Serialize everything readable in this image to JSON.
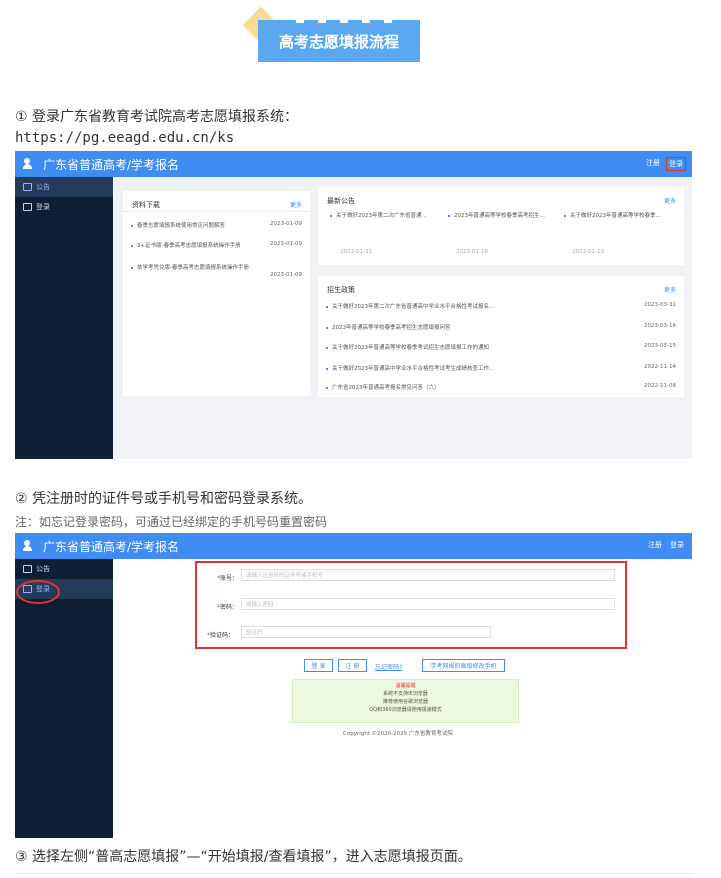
{
  "banner": {
    "title": "高考志愿填报流程"
  },
  "step1": {
    "text": "① 登录广东省教育考试院高考志愿填报系统：",
    "url": "https://pg.eeagd.edu.cn/ks"
  },
  "step2": {
    "text": "② 凭注册时的证件号或手机号和密码登录系统。",
    "note": "注：如忘记登录密码，可通过已经绑定的手机号码重置密码"
  },
  "step3": {
    "text": "③ 选择左侧“普高志愿填报”—“开始填报/查看填报”，进入志愿填报页面。"
  },
  "app": {
    "brand": "广东省普通高考/学考报名",
    "register_link": "注册",
    "login_link": "登录",
    "sidebar": [
      {
        "label": "公告"
      },
      {
        "label": "登录"
      }
    ]
  },
  "downloads": {
    "title": "资料下载",
    "more": "更多",
    "items": [
      {
        "label": "春季志愿填报系统使用常见问题解答",
        "date": "2023-01-09"
      },
      {
        "label": "3+证书版-春季高考志愿填报系统操作手册",
        "date": "2023-01-09"
      },
      {
        "label": "依学考凭兑版-春季高考志愿填报系统操作手册",
        "date": "2023-01-09"
      }
    ]
  },
  "notices": {
    "title": "最新公告",
    "more": "更多",
    "items": [
      {
        "label": "关于做好2023年第二次广东省普通…",
        "date": "2023-01-31"
      },
      {
        "label": "2023年普通高等学校春季高考招生…",
        "date": "2023-01-16"
      },
      {
        "label": "关于做好2023年普通高等学校春季…",
        "date": "2023-01-13"
      }
    ]
  },
  "policies": {
    "title": "招生政策",
    "more": "更多",
    "items": [
      {
        "label": "关于做好2023年第二次广东省普通高中学业水平合格性考试报名…",
        "date": "2023-03-31"
      },
      {
        "label": "2023年普通高等学校春季高考招生志愿填报问答",
        "date": "2023-03-16"
      },
      {
        "label": "关于做好2023年普通高等学校春季考试招生志愿填报工作的通知",
        "date": "2023-03-15"
      },
      {
        "label": "关于做好2023年普通高中学业水平合格性考试考生成绩核查工作…",
        "date": "2022-11-14"
      },
      {
        "label": "广东省2023年普通高考报名常见问答（六）",
        "date": "2022-11-08"
      }
    ]
  },
  "login_form": {
    "account_label": "账号：",
    "account_placeholder": "请输入注册时的证件号或手机号",
    "password_label": "密码：",
    "password_placeholder": "请输入密码",
    "captcha_label": "验证码：",
    "captcha_placeholder": "验证码",
    "login_btn": "登 录",
    "register_btn": "注 册",
    "forgot_link": "忘记密码?",
    "change_phone_btn": "学考网报的高级修改手机",
    "tips": [
      "温馨提醒",
      "系统不支持IE浏览器",
      "推荐使用谷歌浏览器",
      "QQ和360浏览器请使用极速模式"
    ],
    "copyright": "Copyright ©2020-2025 广东省教育考试院"
  },
  "colors": {
    "primary": "#3f8cf3",
    "sidebar": "#0f1e33",
    "highlight": "#e0332e",
    "banner": "#5aa9f0"
  }
}
